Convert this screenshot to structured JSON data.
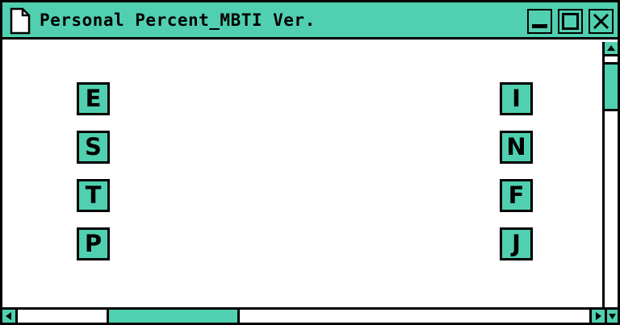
{
  "window": {
    "title": "Personal Percent_MBTI Ver.",
    "accent_color": "#50d0b0",
    "title_icon": "document-icon",
    "controls": [
      {
        "name": "minimize",
        "icon": "minimize-icon"
      },
      {
        "name": "maximize",
        "icon": "maximize-icon"
      },
      {
        "name": "close",
        "icon": "close-icon"
      }
    ]
  },
  "mbti": {
    "left_letters": [
      "E",
      "S",
      "T",
      "P"
    ],
    "right_letters": [
      "I",
      "N",
      "F",
      "J"
    ]
  },
  "scrollbars": {
    "vertical": {
      "up_icon": "arrow-up-icon"
    },
    "horizontal": {
      "left_icon": "arrow-left-icon",
      "right_icon": "arrow-right-icon",
      "down_icon": "arrow-down-icon"
    }
  }
}
